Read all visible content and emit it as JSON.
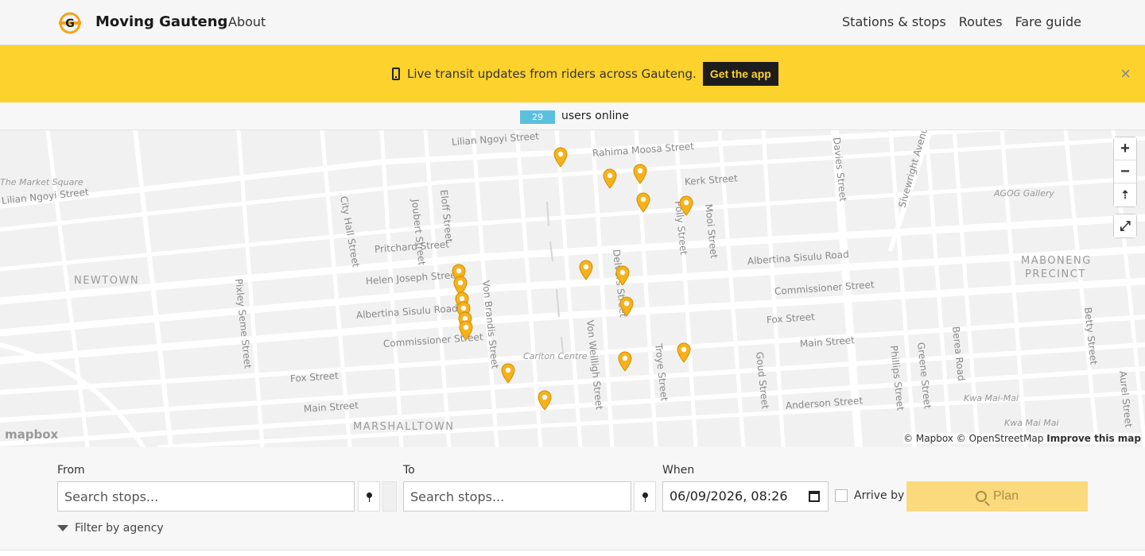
{
  "header": {
    "brand": "Moving Gauteng",
    "about": "About",
    "nav": [
      "Stations & stops",
      "Routes",
      "Fare guide"
    ]
  },
  "banner": {
    "text": "Live transit updates from riders across Gauteng.",
    "button": "Get the app",
    "close": "×"
  },
  "online": {
    "count": "29",
    "label": "users online"
  },
  "map": {
    "streets": [
      "Lilian Ngoyi Street",
      "Rahima Moosa Street",
      "Kerk Street",
      "Lilian Ngoyi Street",
      "City Hall Street",
      "Joubert Street",
      "Eloff Street",
      "Pritchard Street",
      "Helen Joseph Street",
      "Von Brandis Street",
      "Albertina Sisulu Road",
      "Commissioner Street",
      "Fox Street",
      "Main Street",
      "Delvers Street",
      "Von Weilligh Street",
      "Troye Street",
      "Pixley Seme Street",
      "Polly Street",
      "Mooi Street",
      "Albertina Sisulu Road",
      "Commissioner Street",
      "Fox Street",
      "Main Street",
      "Anderson Street",
      "Goud Street",
      "Phillips Street",
      "Greene Street",
      "Berea Road",
      "Betty Street",
      "Aurel Street",
      "Davies Street",
      "Sivewright Avenue"
    ],
    "districts": [
      "NEWTOWN",
      "MARSHALLTOWN",
      "MABONENG",
      "PRECINCT"
    ],
    "pois": [
      "The Market Square",
      "AGOG Gallery",
      "Carlton Centre",
      "Kwa Mai-Mai",
      "Kwa Mai Mai"
    ],
    "zoom_in": "+",
    "zoom_out": "−",
    "reset_north": "⇡",
    "fullscreen": "⤢",
    "logo": "mapbox",
    "attribution_1": "© Mapbox",
    "attribution_2": "© OpenStreetMap",
    "attribution_3": "Improve this map",
    "pin_color": "#f6b21b"
  },
  "form": {
    "from_label": "From",
    "from_placeholder": "Search stops...",
    "to_label": "To",
    "to_placeholder": "Search stops...",
    "when_label": "When",
    "when_value": "06/09/2026, 08:26",
    "arrive_label": "Arrive by",
    "plan_label": "Plan",
    "filter_label": "Filter by agency"
  },
  "colors": {
    "accent": "#fdd22d",
    "badge": "#5bc0de",
    "plan_button": "#fcd669"
  }
}
